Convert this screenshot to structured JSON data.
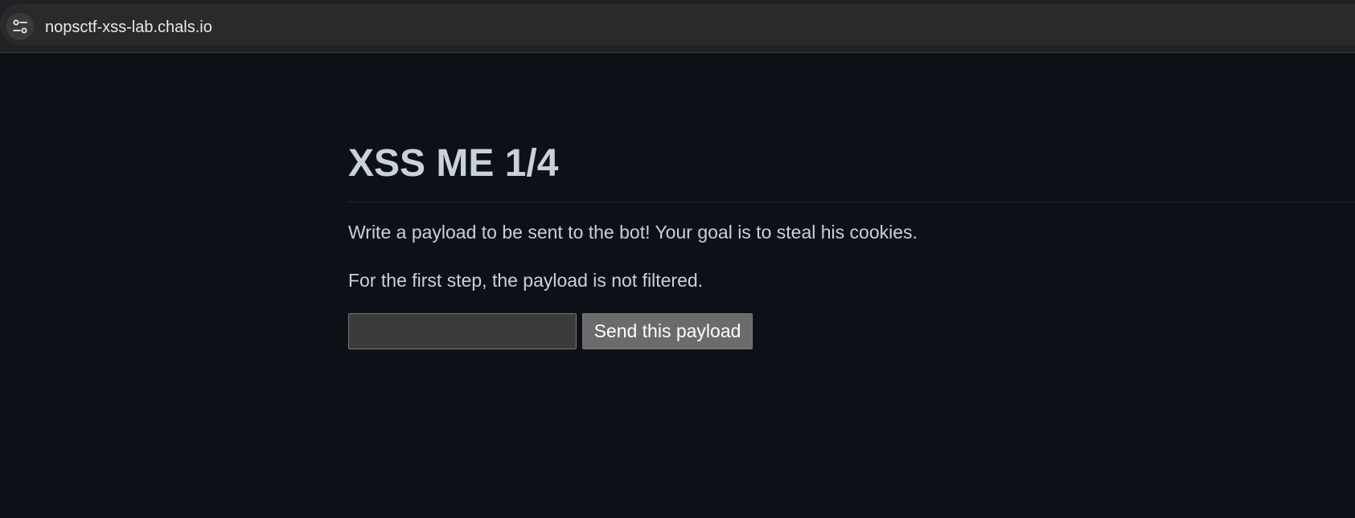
{
  "browser": {
    "url": "nopsctf-xss-lab.chals.io",
    "site_info_icon": "tune-icon"
  },
  "main": {
    "title": "XSS ME 1/4",
    "paragraphs": [
      "Write a payload to be sent to the bot! Your goal is to steal his cookies.",
      "For the first step, the payload is not filtered."
    ],
    "payload_input": {
      "value": "",
      "placeholder": ""
    },
    "send_button_label": "Send this payload"
  },
  "colors": {
    "page_background": "#0d1117",
    "text": "#c9d1d9",
    "button_background": "#6b6b6b",
    "input_background": "#3b3b3b"
  }
}
